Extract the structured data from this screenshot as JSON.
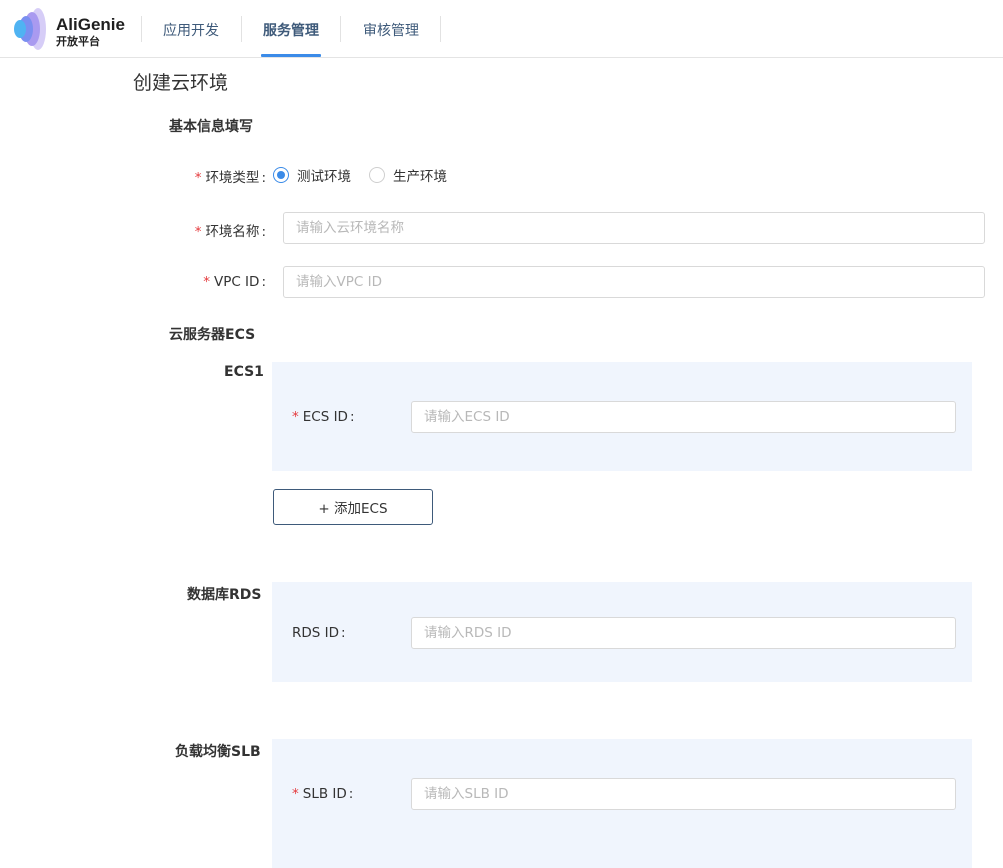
{
  "header": {
    "brand": "AliGenie",
    "brand_sub": "开放平台",
    "nav": [
      {
        "label": "应用开发"
      },
      {
        "label": "服务管理"
      },
      {
        "label": "审核管理"
      }
    ],
    "active_nav": "服务管理"
  },
  "page": {
    "title": "创建云环境"
  },
  "basic": {
    "section_title": "基本信息填写",
    "env_type": {
      "label": "环境类型",
      "options": [
        "测试环境",
        "生产环境"
      ],
      "selected": "测试环境"
    },
    "env_name": {
      "label": "环境名称",
      "placeholder": "请输入云环境名称",
      "value": ""
    },
    "vpc": {
      "label": "VPC ID",
      "placeholder": "请输入VPC ID",
      "value": ""
    }
  },
  "ecs": {
    "section_title": "云服务器ECS",
    "group_label": "ECS1",
    "id_label": "ECS ID",
    "placeholder": "请输入ECS ID",
    "add_button": "+ 添加ECS"
  },
  "rds": {
    "section_title": "数据库RDS",
    "id_label": "RDS ID",
    "placeholder": "请输入RDS ID"
  },
  "slb": {
    "section_title": "负载均衡SLB",
    "id_label": "SLB ID",
    "placeholder": "请输入SLB ID"
  },
  "colors": {
    "accent": "#3b8be8",
    "required": "#e4393c",
    "panel_bg": "#f0f5fd",
    "nav_text": "#3e5a7a"
  },
  "icons": {
    "logo": "aligenie-logo-icon"
  }
}
